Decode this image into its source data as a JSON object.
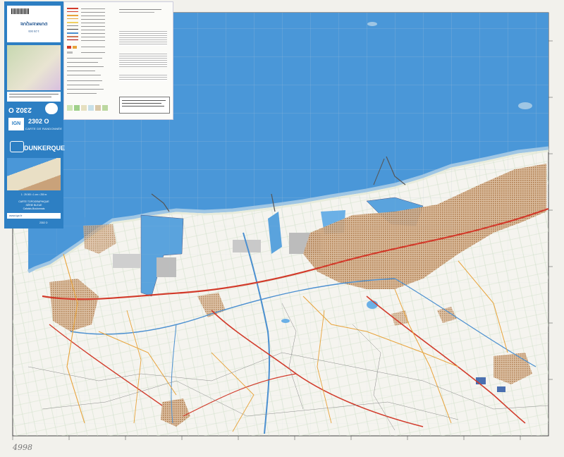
{
  "sheet": {
    "number": "2302 O",
    "number_back": "2302 O",
    "product": "CARTE DE RANDONNÉE",
    "title": "DUNKERQUE",
    "scale_text": "1 : 25 000 • 1 cm = 250 m",
    "series_line1": "CARTE TOPOGRAPHIQUE",
    "series_line2": "SÉRIE BLEUE",
    "series_line3": "Calaisis-Boulonnais",
    "publisher": "IGN",
    "website": "www.ign.fr",
    "back_title": "DUNKERQUE",
    "back_scale": "1:25 000",
    "fold_code": "2302 O"
  },
  "colors": {
    "sea": "#4a97d8",
    "land": "#f4f3ee",
    "urban": "#c9a27a",
    "road_main": "#d23a2a",
    "road_secondary": "#e8a33a",
    "cover_blue": "#2d7fc3",
    "water_blue": "#6bb0e6",
    "beach": "#dfe8ea"
  },
  "annotation": "4998"
}
